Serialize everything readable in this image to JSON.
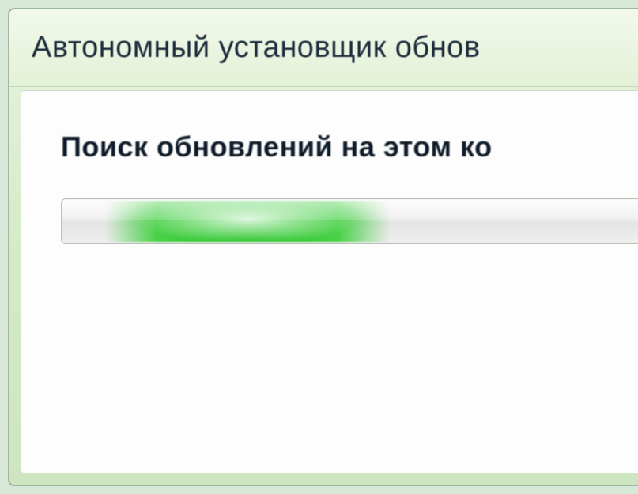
{
  "window": {
    "title": "Автономный установщик обнов"
  },
  "content": {
    "status_text": "Поиск обновлений на этом ко"
  }
}
